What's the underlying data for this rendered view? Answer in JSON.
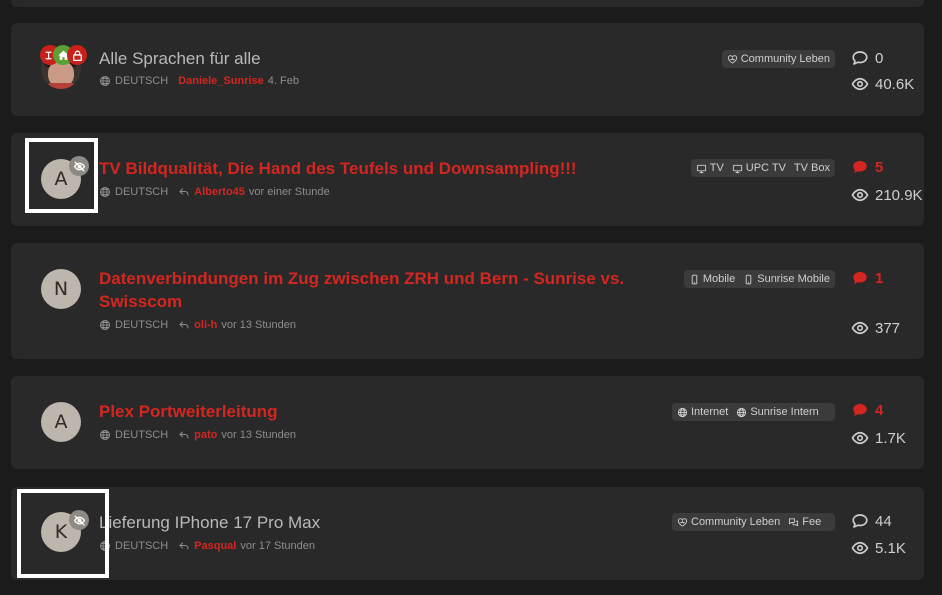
{
  "topics": [
    {
      "title": "Alle Sprachen für alle",
      "unread": false,
      "avatar_letter": "",
      "language": "DEUTSCH",
      "author": "Daniele_Sunrise",
      "time": "4. Feb",
      "tags": [
        {
          "icon": "heart-handshake-icon",
          "label": "Community Leben"
        }
      ],
      "replies": "0",
      "views": "40.6K"
    },
    {
      "title": "TV Bildqualität, Die Hand des Teufels und Downsampling!!!",
      "unread": true,
      "avatar_letter": "A",
      "language": "DEUTSCH",
      "author": "Alberto45",
      "time": "vor einer Stunde",
      "tags": [
        {
          "icon": "tv-icon",
          "label": "TV"
        },
        {
          "icon": "tv-icon",
          "label": "UPC TV"
        },
        {
          "icon": "",
          "label": "TV Box"
        }
      ],
      "replies": "5",
      "views": "210.9K"
    },
    {
      "title_lines": [
        "Datenverbindungen im Zug zwischen ZRH und Bern - Sunrise vs.",
        "Swisscom"
      ],
      "unread": true,
      "avatar_letter": "N",
      "language": "DEUTSCH",
      "author": "oli-h",
      "time": "vor 13 Stunden",
      "tags": [
        {
          "icon": "mobile-icon",
          "label": "Mobile"
        },
        {
          "icon": "mobile-icon",
          "label": "Sunrise Mobile"
        }
      ],
      "replies": "1",
      "views": "377"
    },
    {
      "title": "Plex Portweiterleitung",
      "unread": true,
      "avatar_letter": "A",
      "language": "DEUTSCH",
      "author": "pato",
      "time": "vor 13 Stunden",
      "tags": [
        {
          "icon": "globe-icon",
          "label": "Internet"
        },
        {
          "icon": "globe-icon",
          "label": "Sunrise Intern"
        }
      ],
      "replies": "4",
      "views": "1.7K"
    },
    {
      "title": "Lieferung IPhone 17 Pro Max",
      "unread": false,
      "avatar_letter": "K",
      "language": "DEUTSCH",
      "author": "Pasqual",
      "time": "vor 17 Stunden",
      "tags": [
        {
          "icon": "heart-handshake-icon",
          "label": "Community Leben"
        },
        {
          "icon": "feedback-icon",
          "label": "Fee"
        }
      ],
      "replies": "44",
      "views": "5.1K"
    }
  ],
  "colors": {
    "accent": "#d42620",
    "card": "#292929",
    "background": "#1b1b1b",
    "tag_bg": "#3b3b3b"
  }
}
